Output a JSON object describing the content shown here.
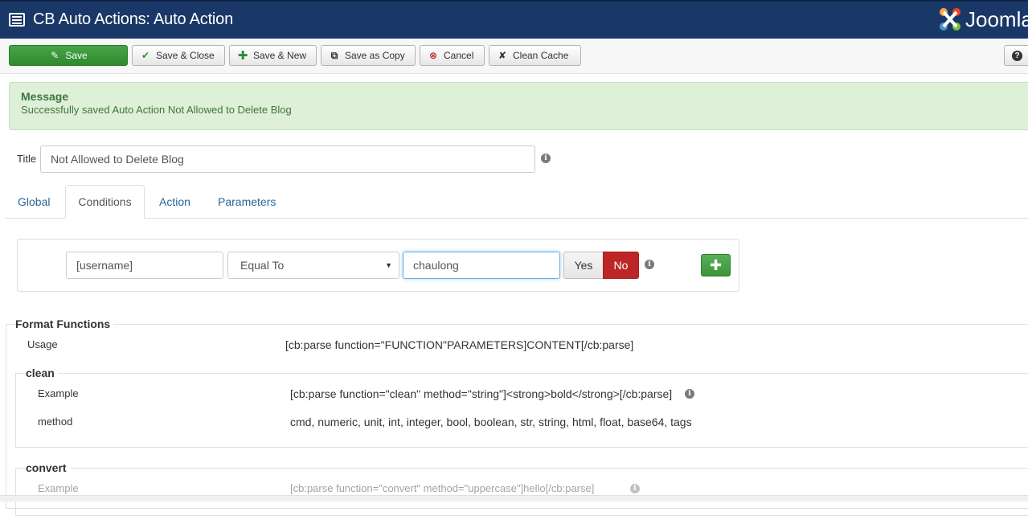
{
  "header": {
    "title": "CB Auto Actions: Auto Action",
    "brand": "Joomla!"
  },
  "toolbar": {
    "save": "Save",
    "save_close": "Save & Close",
    "save_new": "Save & New",
    "save_copy": "Save as Copy",
    "cancel": "Cancel",
    "clean_cache": "Clean Cache",
    "help_icon": "question-icon"
  },
  "message": {
    "heading": "Message",
    "text": "Successfully saved Auto Action Not Allowed to Delete Blog"
  },
  "form": {
    "title_label": "Title",
    "title_value": "Not Allowed to Delete Blog"
  },
  "tabs": [
    "Global",
    "Conditions",
    "Action",
    "Parameters"
  ],
  "active_tab": "Conditions",
  "condition": {
    "field": "[username]",
    "operator": "Equal To",
    "value": "chaulong",
    "yes": "Yes",
    "no": "No",
    "toggle_state": "No",
    "add_icon": "plus-icon"
  },
  "format_functions": {
    "legend": "Format Functions",
    "usage_label": "Usage",
    "usage_value": "[cb:parse function=\"FUNCTION\"PARAMETERS]CONTENT[/cb:parse]",
    "clean": {
      "legend": "clean",
      "example_label": "Example",
      "example_value": "[cb:parse function=\"clean\" method=\"string\"]<strong>bold</strong>[/cb:parse]",
      "method_label": "method",
      "method_value": "cmd, numeric, unit, int, integer, bool, boolean, str, string, html, float, base64, tags"
    },
    "convert": {
      "legend": "convert",
      "example_label": "Example",
      "example_value": "[cb:parse function=\"convert\" method=\"uppercase\"]hello[/cb:parse]"
    }
  },
  "colors": {
    "header_bg": "#1a3867",
    "save_green": "#3a953a",
    "alert_bg": "#dff0d8",
    "no_red": "#bd2626",
    "link_blue": "#2a6496"
  }
}
